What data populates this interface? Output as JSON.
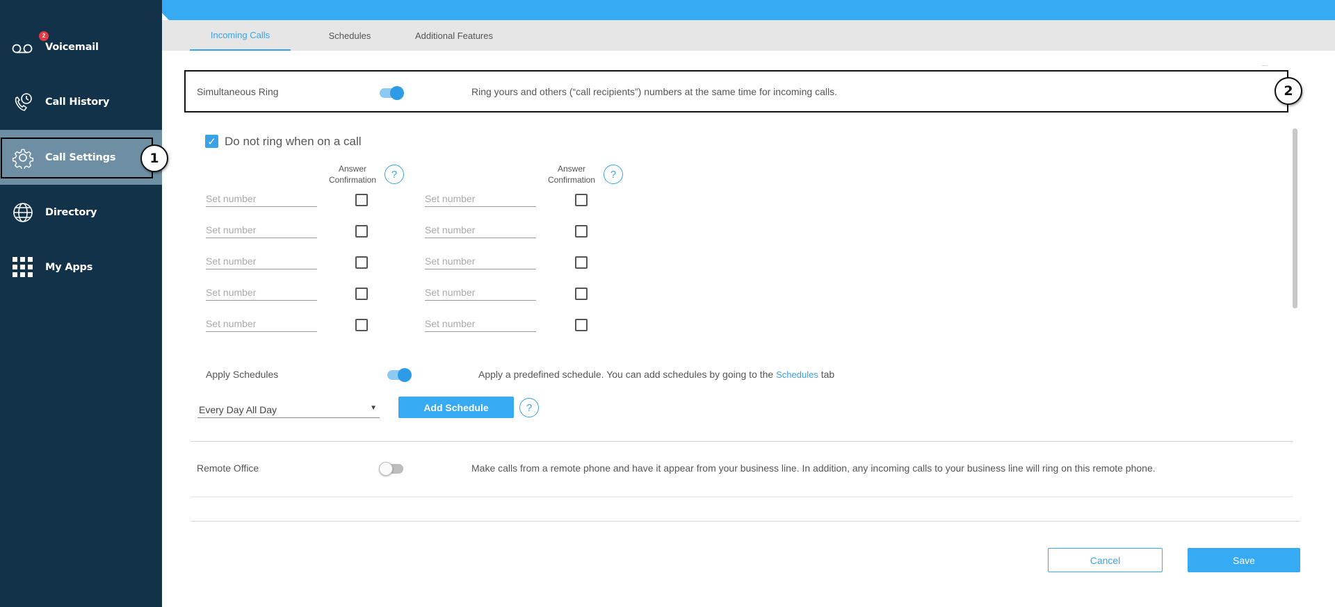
{
  "sidebar": {
    "items": [
      {
        "label": "Voicemail",
        "icon": "voicemail-icon",
        "badge": "2"
      },
      {
        "label": "Call History",
        "icon": "call-history-icon"
      },
      {
        "label": "Call Settings",
        "icon": "gear-icon",
        "active": true
      },
      {
        "label": "Directory",
        "icon": "globe-icon"
      },
      {
        "label": "My Apps",
        "icon": "apps-grid-icon"
      }
    ]
  },
  "callouts": {
    "one": "1",
    "two": "2"
  },
  "tabs": [
    {
      "label": "Incoming Calls",
      "active": true
    },
    {
      "label": "Schedules"
    },
    {
      "label": "Additional Features"
    }
  ],
  "simultaneous_ring": {
    "label": "Simultaneous Ring",
    "enabled": true,
    "description": "Ring yours and others (“call recipients”) numbers at the same time for incoming calls."
  },
  "do_not_ring": {
    "label": "Do not ring when on a call",
    "checked": true
  },
  "recipients": {
    "answer_confirmation_header": "Answer\nConfirmation",
    "help_icon": "?",
    "placeholder": "Set number",
    "rows": 5
  },
  "apply_schedules": {
    "label": "Apply Schedules",
    "enabled": true,
    "description_prefix": "Apply a predefined schedule. You can add schedules by going to the",
    "link": "Schedules",
    "description_suffix": "tab",
    "selected_schedule": "Every Day All Day",
    "add_button": "Add Schedule"
  },
  "remote_office": {
    "label": "Remote Office",
    "enabled": false,
    "description": "Make calls from a remote phone and have it appear from your business line. In addition, any incoming calls to your business line will ring on this remote phone."
  },
  "footer": {
    "cancel": "Cancel",
    "save": "Save"
  },
  "colors": {
    "sidebar": "#123249",
    "accent": "#36aaf2",
    "active_nav": "#6e8fa3"
  }
}
